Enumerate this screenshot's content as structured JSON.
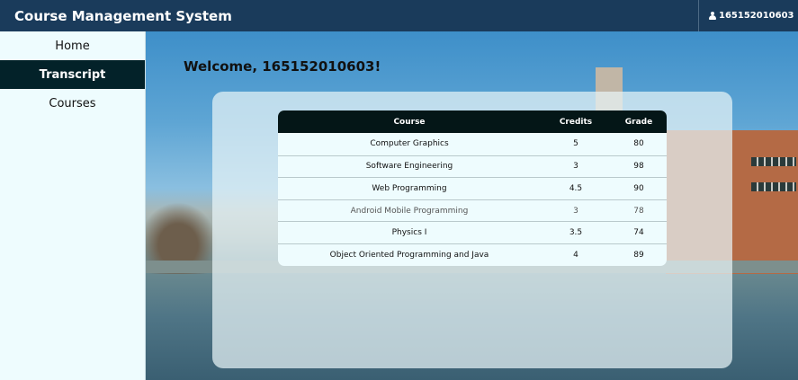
{
  "header": {
    "brand": "Course Management System",
    "user": "165152010603"
  },
  "sidebar": {
    "items": [
      {
        "label": "Home"
      },
      {
        "label": "Transcript"
      },
      {
        "label": "Courses"
      }
    ]
  },
  "main": {
    "welcome": "Welcome, 165152010603!"
  },
  "table": {
    "headers": {
      "course": "Course",
      "credits": "Credits",
      "grade": "Grade"
    },
    "rows": [
      {
        "course": "Computer Graphics",
        "credits": "5",
        "grade": "80"
      },
      {
        "course": "Software Engineering",
        "credits": "3",
        "grade": "98"
      },
      {
        "course": "Web Programming",
        "credits": "4.5",
        "grade": "90"
      },
      {
        "course": "Android Mobile Programming",
        "credits": "3",
        "grade": "78"
      },
      {
        "course": "Physics I",
        "credits": "3.5",
        "grade": "74"
      },
      {
        "course": "Object Oriented Programming and Java",
        "credits": "4",
        "grade": "89"
      }
    ]
  },
  "colors": {
    "topbar": "#1a3b5b",
    "sidebar_bg": "#eefcfe",
    "active_nav": "#032229",
    "table_header": "#041617"
  },
  "icons": {
    "user": "user-icon",
    "dropdown": "caret-down-icon"
  }
}
